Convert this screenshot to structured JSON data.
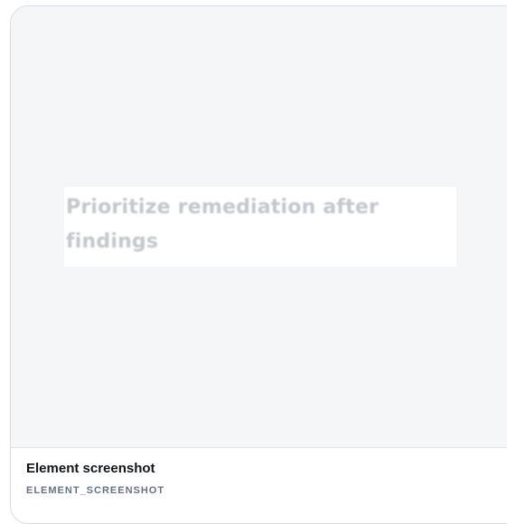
{
  "card": {
    "preview": {
      "snippet_text": "Prioritize remediation after findings"
    },
    "title": "Element screenshot",
    "kind": "ELEMENT_SCREENSHOT"
  }
}
